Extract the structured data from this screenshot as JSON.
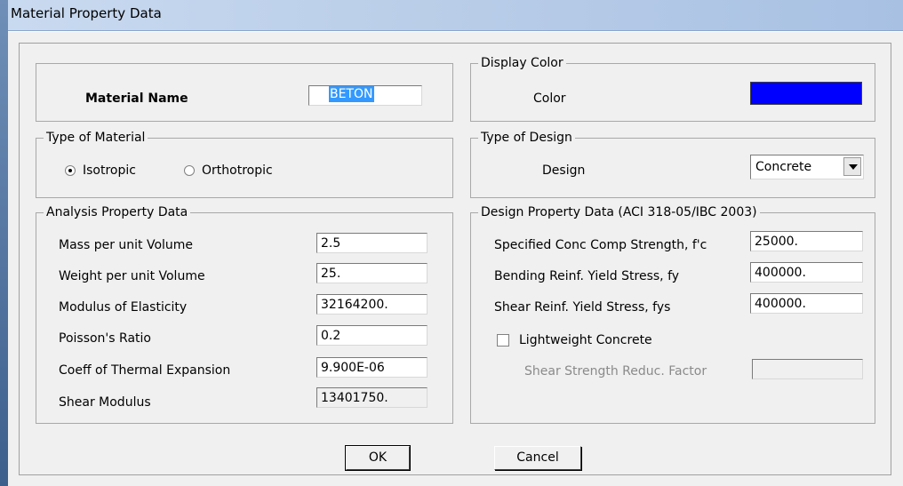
{
  "window": {
    "title": "Material Property Data"
  },
  "material_name": {
    "label": "Material Name",
    "value": "BETON"
  },
  "display_color": {
    "group_title": "Display Color",
    "label": "Color",
    "color": "#0000ff"
  },
  "type_of_material": {
    "group_title": "Type of Material",
    "options": [
      {
        "label": "Isotropic",
        "selected": true
      },
      {
        "label": "Orthotropic",
        "selected": false
      }
    ]
  },
  "type_of_design": {
    "group_title": "Type of Design",
    "label": "Design",
    "selected": "Concrete"
  },
  "analysis": {
    "group_title": "Analysis Property Data",
    "rows": [
      {
        "label": "Mass per unit Volume",
        "value": "2.5"
      },
      {
        "label": "Weight per unit Volume",
        "value": "25."
      },
      {
        "label": "Modulus of Elasticity",
        "value": "32164200."
      },
      {
        "label": "Poisson's Ratio",
        "value": "0.2"
      },
      {
        "label": "Coeff of Thermal Expansion",
        "value": "9.900E-06"
      },
      {
        "label": "Shear Modulus",
        "value": "13401750."
      }
    ]
  },
  "design": {
    "group_title": "Design Property Data (ACI 318-05/IBC 2003)",
    "rows": [
      {
        "label": "Specified Conc Comp Strength, f'c",
        "value": "25000."
      },
      {
        "label": "Bending Reinf. Yield Stress, fy",
        "value": "400000."
      },
      {
        "label": "Shear Reinf. Yield Stress, fys",
        "value": "400000."
      }
    ],
    "lightweight": {
      "label": "Lightweight Concrete",
      "checked": false
    },
    "shear_reduc": {
      "label": "Shear Strength Reduc. Factor",
      "value": ""
    }
  },
  "buttons": {
    "ok": "OK",
    "cancel": "Cancel"
  }
}
